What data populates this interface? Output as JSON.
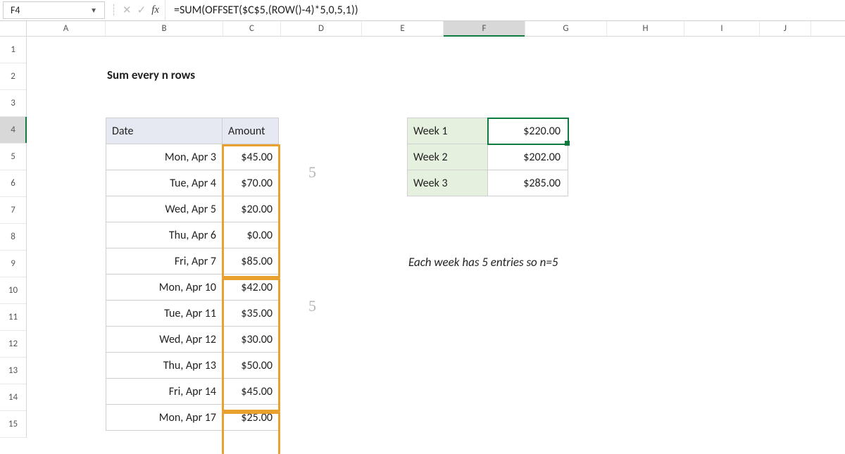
{
  "formula_bar": {
    "cell_ref": "F4",
    "fx_label": "fx",
    "formula": "=SUM(OFFSET($C$5,(ROW()-4)*5,0,5,1))"
  },
  "columns": [
    "A",
    "B",
    "C",
    "D",
    "E",
    "F",
    "G",
    "H",
    "I",
    "J"
  ],
  "selected_column_index": 5,
  "rows": [
    "1",
    "2",
    "3",
    "4",
    "5",
    "6",
    "7",
    "8",
    "9",
    "10",
    "11",
    "12",
    "13",
    "14",
    "15"
  ],
  "selected_row_index": 3,
  "title": "Sum every n rows",
  "table": {
    "headers": {
      "date": "Date",
      "amount": "Amount"
    },
    "rows": [
      {
        "date": "Mon, Apr 3",
        "amount": "$45.00"
      },
      {
        "date": "Tue, Apr 4",
        "amount": "$70.00"
      },
      {
        "date": "Wed, Apr 5",
        "amount": "$20.00"
      },
      {
        "date": "Thu, Apr 6",
        "amount": "$0.00"
      },
      {
        "date": "Fri, Apr 7",
        "amount": "$85.00"
      },
      {
        "date": "Mon, Apr 10",
        "amount": "$42.00"
      },
      {
        "date": "Tue, Apr 11",
        "amount": "$35.00"
      },
      {
        "date": "Wed, Apr 12",
        "amount": "$30.00"
      },
      {
        "date": "Thu, Apr 13",
        "amount": "$50.00"
      },
      {
        "date": "Fri, Apr 14",
        "amount": "$45.00"
      },
      {
        "date": "Mon, Apr 17",
        "amount": "$25.00"
      }
    ]
  },
  "weeks": [
    {
      "label": "Week 1",
      "value": "$220.00"
    },
    {
      "label": "Week 2",
      "value": "$202.00"
    },
    {
      "label": "Week 3",
      "value": "$285.00"
    }
  ],
  "annotation_5a": "5",
  "annotation_5b": "5",
  "note_text": "Each week has 5 entries so n=5"
}
